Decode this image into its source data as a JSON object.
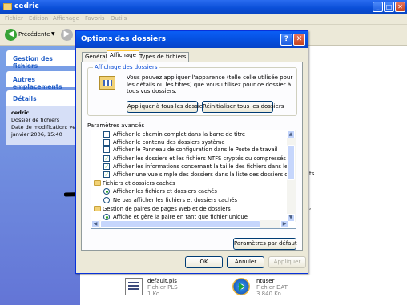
{
  "background_window": {
    "title": "cedric",
    "menu": [
      "Fichier",
      "Edition",
      "Affichage",
      "Favoris",
      "Outils"
    ],
    "toolbar": {
      "back_label": "Précédente"
    },
    "left_panel": {
      "gestion": "Gestion des fichiers",
      "autres": "Autres emplacements",
      "details": {
        "header": "Détails",
        "name": "cedric",
        "type": "Dossier de fichiers",
        "modified": "Date de modification: ver",
        "modified_date": "janvier 2006, 15:40"
      }
    },
    "files": [
      {
        "name": "default.pls",
        "type": "Fichier PLS",
        "size": "1 Ko"
      },
      {
        "name": "ntuser",
        "type": "Fichier DAT",
        "size": "3 840 Ko"
      }
    ]
  },
  "dialog": {
    "title": "Options des dossiers",
    "tabs": [
      "Général",
      "Affichage",
      "Types de fichiers"
    ],
    "active_tab": "Affichage",
    "group_title": "Affichage des dossiers",
    "group_text": "Vous pouvez appliquer l'apparence (telle celle utilisée pour les détails ou les titres) que vous utilisez pour ce dossier à tous vos dossiers.",
    "apply_all_button": "Appliquer à tous les dossiers",
    "reset_all_button": "Réinitialiser tous les dossiers",
    "advanced_label": "Paramètres avancés :",
    "settings": [
      {
        "kind": "checkbox",
        "checked": false,
        "label": "Afficher le chemin complet dans la barre de titre"
      },
      {
        "kind": "checkbox",
        "checked": false,
        "label": "Afficher le contenu des dossiers système"
      },
      {
        "kind": "checkbox",
        "checked": false,
        "label": "Afficher le Panneau de configuration dans le Poste de travail"
      },
      {
        "kind": "checkbox",
        "checked": true,
        "label": "Afficher les dossiers et les fichiers NTFS cryptés ou compressés en coule"
      },
      {
        "kind": "checkbox",
        "checked": true,
        "label": "Afficher les informations concernant la taille des fichiers dans les info-bulle"
      },
      {
        "kind": "checkbox",
        "checked": true,
        "label": "Afficher une vue simple des dossiers dans la liste des dossiers de l'Explor"
      },
      {
        "kind": "folder",
        "label": "Fichiers et dossiers cachés"
      },
      {
        "kind": "radio",
        "checked": true,
        "label": "Afficher les fichiers et dossiers cachés"
      },
      {
        "kind": "radio",
        "checked": false,
        "label": "Ne pas afficher les fichiers et dossiers cachés"
      },
      {
        "kind": "folder",
        "label": "Gestion de paires de pages Web et de dossiers"
      },
      {
        "kind": "radio",
        "checked": true,
        "label": "Affiche et gère la paire en tant que fichier unique"
      }
    ],
    "default_button": "Paramètres par défaut",
    "ok_button": "OK",
    "cancel_button": "Annuler",
    "apply_button": "Appliquer"
  }
}
